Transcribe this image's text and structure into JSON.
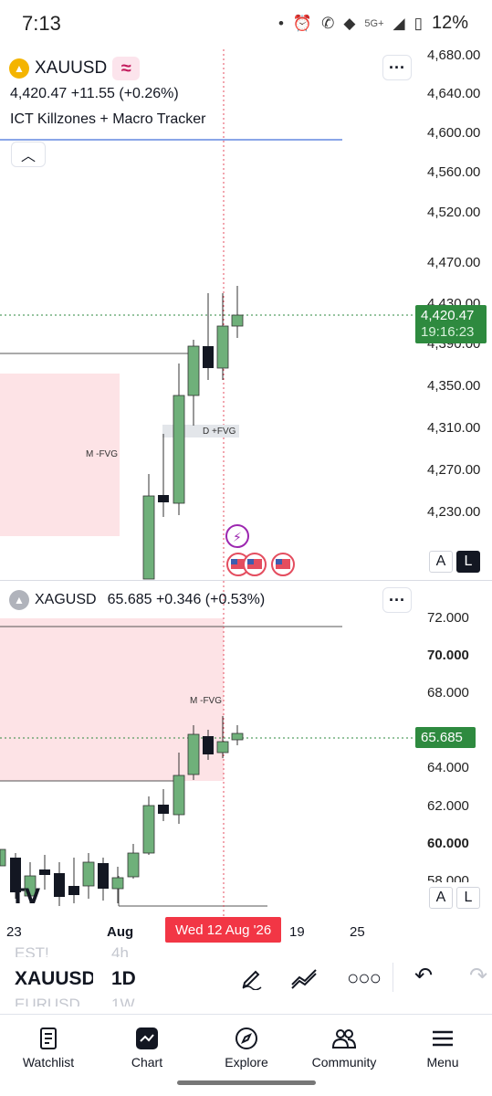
{
  "status": {
    "time": "7:13",
    "network": "5G+",
    "battery": "12%"
  },
  "top_pane": {
    "symbol": "XAUUSD",
    "price_line": "4,420.47  +11.55 (+0.26%)",
    "indicator": "ICT Killzones + Macro Tracker",
    "axis_ticks": [
      "4,680.00",
      "4,640.00",
      "4,600.00",
      "4,560.00",
      "4,520.00",
      "4,470.00",
      "4,430.00",
      "4,390.00",
      "4,350.00",
      "4,310.00",
      "4,270.00",
      "4,230.00"
    ],
    "last_price": "4,420.47",
    "countdown": "19:16:23",
    "mfvg_label": "M -FVG",
    "dfvg_label": "D +FVG",
    "scale_a": "A",
    "scale_l": "L"
  },
  "bottom_pane": {
    "symbol": "XAGUSD",
    "price_line": "65.685  +0.346 (+0.53%)",
    "axis_ticks": [
      "72.000",
      "70.000",
      "68.000",
      "64.000",
      "62.000",
      "60.000",
      "58.000"
    ],
    "last_price": "65.685",
    "mfvg_label": "M -FVG",
    "scale_a": "A",
    "scale_l": "L"
  },
  "time_axis": {
    "labels": [
      "23",
      "Aug",
      "19",
      "25"
    ],
    "crosshair_date": "Wed 12 Aug '26"
  },
  "toolbar": {
    "symbol": "XAUUSD",
    "symbol_prev": "EST!",
    "symbol_next": "EURUSD",
    "interval": "1D",
    "interval_prev": "4h",
    "interval_next": "1W"
  },
  "nav": {
    "watchlist": "Watchlist",
    "chart": "Chart",
    "explore": "Explore",
    "community": "Community",
    "menu": "Menu"
  },
  "colors": {
    "up": "#6fb07a",
    "down": "#131722",
    "fvg_fill": "#fde3e6",
    "badge": "#2e8a3f",
    "crosshair": "#e44d5f",
    "date_badge": "#f23645",
    "blue_line": "#8aa6e8",
    "accent_macro": "#c2185b"
  }
}
